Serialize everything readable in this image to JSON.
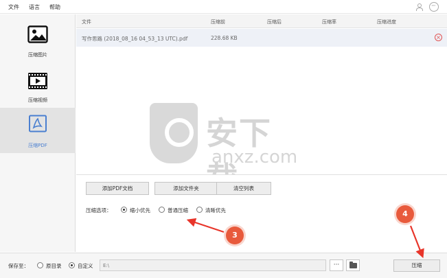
{
  "menu": {
    "file": "文件",
    "language": "语言",
    "help": "帮助"
  },
  "top_icons": {
    "user": "user-icon",
    "chat": "chat-icon"
  },
  "sidebar": {
    "items": [
      {
        "label": "压缩图片",
        "icon": "image-icon",
        "active": false
      },
      {
        "label": "压缩视频",
        "icon": "video-icon",
        "active": false
      },
      {
        "label": "压缩PDF",
        "icon": "pdf-icon",
        "active": true
      }
    ]
  },
  "table": {
    "headers": [
      "文件",
      "压缩前",
      "压缩后",
      "压缩率",
      "压缩进度"
    ],
    "rows": [
      {
        "file": "写作思路 (2018_08_16 04_53_13 UTC).pdf",
        "before": "228.68 KB",
        "after": "",
        "rate": "",
        "progress": ""
      }
    ]
  },
  "watermark": {
    "cn": "安下载",
    "en": "anxz.com"
  },
  "actions": {
    "add_pdf": "添加PDF文档",
    "add_folder": "添加文件夹",
    "clear_list": "清空列表"
  },
  "options": {
    "label": "压缩选项：",
    "choices": [
      {
        "label": "缩小优先",
        "checked": true
      },
      {
        "label": "普通压缩",
        "checked": false
      },
      {
        "label": "清晰优先",
        "checked": false
      }
    ]
  },
  "save": {
    "label": "保存至：",
    "original_dir": "原目录",
    "custom": "自定义",
    "custom_checked": true,
    "path": "E:\\",
    "browse": "···",
    "compress": "压缩"
  },
  "annotations": {
    "step3": "3",
    "step4": "4"
  },
  "colors": {
    "accent": "#4a7fd0",
    "annotation": "#e85a3c",
    "remove": "#e05252"
  }
}
